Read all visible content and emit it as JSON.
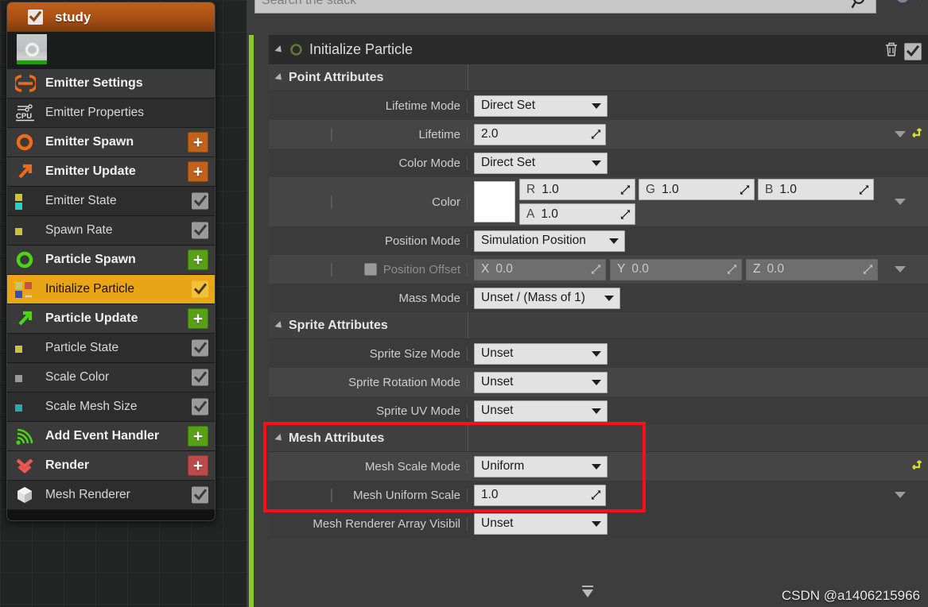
{
  "window": {
    "background_color": "#3d3d3d",
    "accent_green": "#8ac926",
    "highlight_color": "#e8a617",
    "redbox_color": "#fb0d1b"
  },
  "sidebar": {
    "node_title": "study",
    "items": [
      {
        "label": "Emitter Settings",
        "icon": "emitter-settings-icon",
        "kind": "group",
        "action": "none",
        "row": "group"
      },
      {
        "label": "Emitter Properties",
        "icon": "cpu-icon",
        "kind": "module",
        "action": "none",
        "row": "alt"
      },
      {
        "label": "Emitter Spawn",
        "icon": "ring-orange-icon",
        "kind": "group",
        "action": "plus-orange",
        "row": "group"
      },
      {
        "label": "Emitter Update",
        "icon": "arrow-orange-icon",
        "kind": "group",
        "action": "plus-orange",
        "row": "group"
      },
      {
        "label": "Emitter State",
        "icon": "attr-squares-icon",
        "kind": "module",
        "action": "check",
        "row": "alt"
      },
      {
        "label": "Spawn Rate",
        "icon": "attr-squares-icon",
        "kind": "module",
        "action": "check",
        "row": "module"
      },
      {
        "label": "Particle Spawn",
        "icon": "ring-green-icon",
        "kind": "group",
        "action": "plus-green",
        "row": "group"
      },
      {
        "label": "Initialize Particle",
        "icon": "attr-squares-icon",
        "kind": "module",
        "action": "check-gold",
        "row": "selected"
      },
      {
        "label": "Particle Update",
        "icon": "arrow-green-icon",
        "kind": "group",
        "action": "plus-green",
        "row": "group"
      },
      {
        "label": "Particle State",
        "icon": "attr-squares-icon",
        "kind": "module",
        "action": "check",
        "row": "alt"
      },
      {
        "label": "Scale Color",
        "icon": "attr-squares-icon",
        "kind": "module",
        "action": "check",
        "row": "module"
      },
      {
        "label": "Scale Mesh Size",
        "icon": "attr-squares-icon",
        "kind": "module",
        "action": "check",
        "row": "alt"
      },
      {
        "label": "Add Event Handler",
        "icon": "signal-green-icon",
        "kind": "group",
        "action": "plus-green",
        "row": "group"
      },
      {
        "label": "Render",
        "icon": "chevrons-red-icon",
        "kind": "group",
        "action": "plus-red",
        "row": "group"
      },
      {
        "label": "Mesh Renderer",
        "icon": "cube-icon",
        "kind": "module",
        "action": "check",
        "row": "alt"
      }
    ]
  },
  "search": {
    "placeholder": "Search the stack",
    "value": "",
    "icon": "search-icon"
  },
  "module": {
    "title": "Initialize Particle",
    "delete_icon": "trash-icon",
    "enabled_icon": "check-icon"
  },
  "sections": [
    {
      "title": "Point Attributes",
      "rows": [
        {
          "name": "Lifetime Mode",
          "type": "combo",
          "value": "Direct Set",
          "shade": "dark",
          "indent": 0,
          "enabled": true,
          "caret": false,
          "reset": false
        },
        {
          "name": "Lifetime",
          "type": "number",
          "value": "2.0",
          "shade": "light",
          "indent": 1,
          "enabled": true,
          "caret": true,
          "reset": true
        },
        {
          "name": "Color Mode",
          "type": "combo",
          "value": "Direct Set",
          "shade": "dark",
          "indent": 0,
          "enabled": true,
          "caret": false,
          "reset": false
        },
        {
          "name": "Color",
          "type": "color",
          "shade": "light",
          "indent": 1,
          "enabled": true,
          "caret": true,
          "reset": false,
          "swatch": "#ffffff",
          "channels": [
            {
              "axis": "R",
              "value": "1.0"
            },
            {
              "axis": "G",
              "value": "1.0"
            },
            {
              "axis": "B",
              "value": "1.0"
            },
            {
              "axis": "A",
              "value": "1.0"
            }
          ]
        },
        {
          "name": "Position Mode",
          "type": "combo",
          "value": "Simulation Position",
          "shade": "dark",
          "indent": 0,
          "enabled": true,
          "caret": false,
          "reset": false
        },
        {
          "name": "Position Offset",
          "type": "vector3",
          "shade": "light",
          "indent": 1,
          "enabled": false,
          "caret": true,
          "reset": false,
          "checkbox": true,
          "channels": [
            {
              "axis": "X",
              "value": "0.0"
            },
            {
              "axis": "Y",
              "value": "0.0"
            },
            {
              "axis": "Z",
              "value": "0.0"
            }
          ]
        },
        {
          "name": "Mass Mode",
          "type": "combo",
          "value": "Unset / (Mass of 1)",
          "shade": "dark",
          "indent": 0,
          "enabled": true,
          "caret": false,
          "reset": false
        }
      ]
    },
    {
      "title": "Sprite Attributes",
      "rows": [
        {
          "name": "Sprite Size Mode",
          "type": "combo",
          "value": "Unset",
          "shade": "dark",
          "indent": 0,
          "enabled": true,
          "caret": false,
          "reset": false
        },
        {
          "name": "Sprite Rotation Mode",
          "type": "combo",
          "value": "Unset",
          "shade": "light",
          "indent": 0,
          "enabled": true,
          "caret": false,
          "reset": false
        },
        {
          "name": "Sprite UV Mode",
          "type": "combo",
          "value": "Unset",
          "shade": "dark",
          "indent": 0,
          "enabled": true,
          "caret": false,
          "reset": false
        }
      ]
    },
    {
      "title": "Mesh Attributes",
      "highlighted": true,
      "rows": [
        {
          "name": "Mesh Scale Mode",
          "type": "combo",
          "value": "Uniform",
          "shade": "light",
          "indent": 0,
          "enabled": true,
          "caret": false,
          "reset": true
        },
        {
          "name": "Mesh Uniform Scale",
          "type": "number",
          "value": "1.0",
          "shade": "dark",
          "indent": 1,
          "enabled": true,
          "caret": true,
          "reset": false
        }
      ]
    },
    {
      "title": "",
      "rows": [
        {
          "name": "Mesh Renderer Array Visibil",
          "type": "combo",
          "value": "Unset",
          "shade": "dark",
          "indent": 0,
          "enabled": true,
          "caret": false,
          "reset": false
        }
      ]
    }
  ],
  "watermark": "CSDN @a1406215966"
}
